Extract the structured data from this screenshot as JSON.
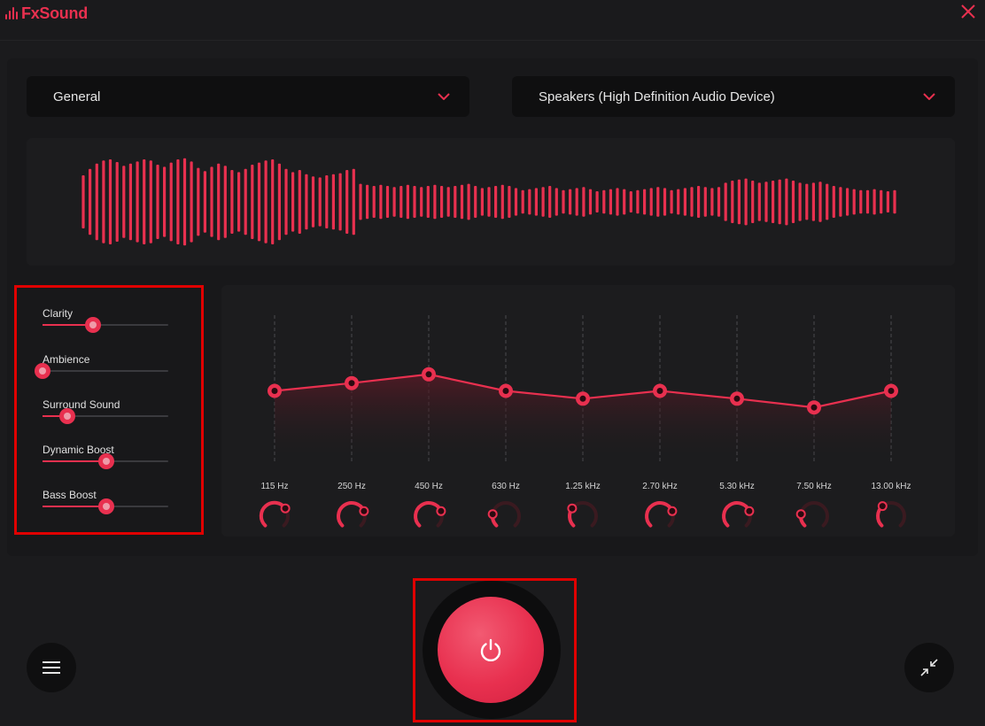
{
  "app": {
    "name": "FxSound",
    "brand_color": "#e8304f"
  },
  "titlebar": {
    "close_icon": "close-icon"
  },
  "preset_dropdown": {
    "value": "General"
  },
  "device_dropdown": {
    "value": "Speakers (High Definition Audio Device)"
  },
  "effects": [
    {
      "label": "Clarity",
      "value": 0.4
    },
    {
      "label": "Ambience",
      "value": 0.0
    },
    {
      "label": "Surround Sound",
      "value": 0.2
    },
    {
      "label": "Dynamic Boost",
      "value": 0.51
    },
    {
      "label": "Bass Boost",
      "value": 0.51
    }
  ],
  "equalizer": {
    "bands": [
      {
        "label": "115 Hz",
        "gain": 0.55,
        "knob": 0.7
      },
      {
        "label": "250 Hz",
        "gain": 0.63,
        "knob": 0.75
      },
      {
        "label": "450 Hz",
        "gain": 0.72,
        "knob": 0.75
      },
      {
        "label": "630 Hz",
        "gain": 0.55,
        "knob": 0.2
      },
      {
        "label": "1.25 kHz",
        "gain": 0.47,
        "knob": 0.3
      },
      {
        "label": "2.70 kHz",
        "gain": 0.55,
        "knob": 0.75
      },
      {
        "label": "5.30 kHz",
        "gain": 0.47,
        "knob": 0.75
      },
      {
        "label": "7.50 kHz",
        "gain": 0.38,
        "knob": 0.2
      },
      {
        "label": "13.00 kHz",
        "gain": 0.55,
        "knob": 0.35
      }
    ]
  },
  "waveform": {
    "amplitudes": [
      0.5,
      0.62,
      0.72,
      0.78,
      0.8,
      0.75,
      0.68,
      0.72,
      0.76,
      0.8,
      0.78,
      0.7,
      0.66,
      0.74,
      0.8,
      0.82,
      0.76,
      0.64,
      0.58,
      0.66,
      0.72,
      0.68,
      0.6,
      0.56,
      0.62,
      0.7,
      0.74,
      0.78,
      0.8,
      0.72,
      0.62,
      0.56,
      0.6,
      0.52,
      0.48,
      0.46,
      0.5,
      0.52,
      0.54,
      0.6,
      0.62,
      0.34,
      0.32,
      0.3,
      0.32,
      0.3,
      0.28,
      0.3,
      0.32,
      0.3,
      0.28,
      0.3,
      0.32,
      0.3,
      0.28,
      0.3,
      0.32,
      0.34,
      0.3,
      0.26,
      0.28,
      0.3,
      0.32,
      0.3,
      0.26,
      0.22,
      0.24,
      0.26,
      0.28,
      0.3,
      0.26,
      0.22,
      0.24,
      0.26,
      0.28,
      0.24,
      0.2,
      0.22,
      0.24,
      0.26,
      0.24,
      0.2,
      0.22,
      0.24,
      0.26,
      0.28,
      0.26,
      0.22,
      0.24,
      0.26,
      0.28,
      0.3,
      0.28,
      0.26,
      0.28,
      0.36,
      0.4,
      0.42,
      0.44,
      0.4,
      0.36,
      0.38,
      0.4,
      0.42,
      0.44,
      0.4,
      0.36,
      0.34,
      0.36,
      0.38,
      0.34,
      0.3,
      0.28,
      0.26,
      0.24,
      0.22,
      0.22,
      0.24,
      0.22,
      0.2,
      0.22
    ]
  },
  "bottom": {
    "menu_icon": "menu-icon",
    "power_icon": "power-icon",
    "shrink_icon": "shrink-icon"
  }
}
